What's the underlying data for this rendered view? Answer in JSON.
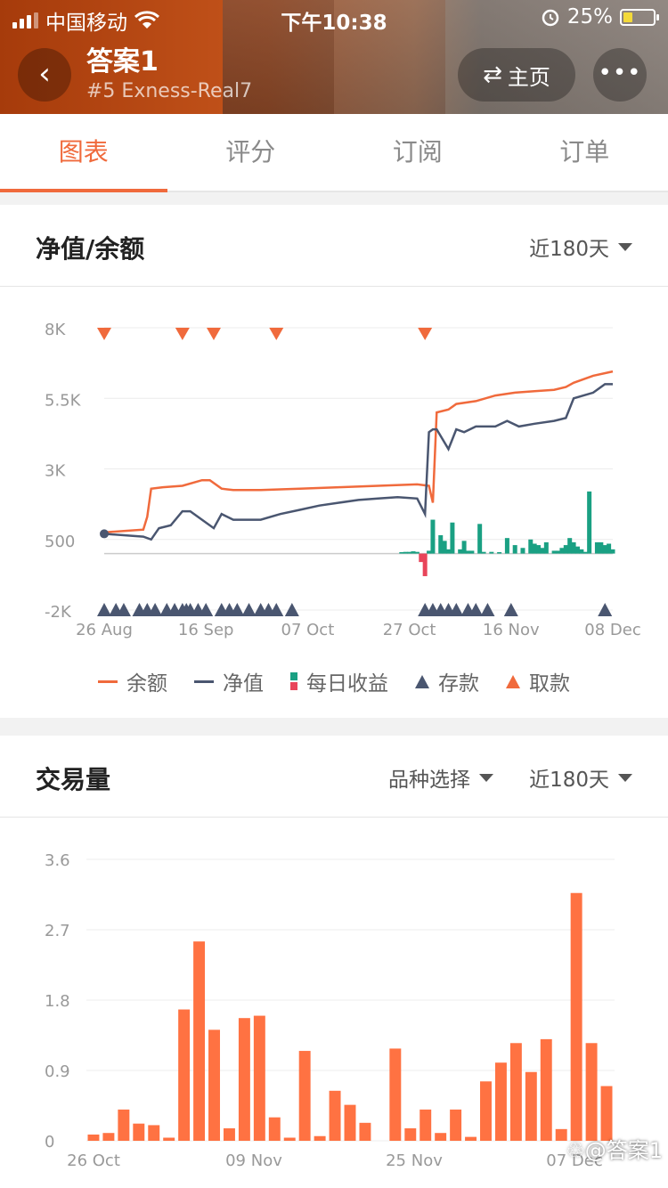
{
  "status_bar": {
    "carrier": "中国移动",
    "time": "下午10:38",
    "battery": "25%"
  },
  "header": {
    "title": "答案1",
    "subtitle": "#5 Exness-Real7",
    "home_label": "主页"
  },
  "tabs": [
    {
      "label": "图表"
    },
    {
      "label": "评分"
    },
    {
      "label": "订阅"
    },
    {
      "label": "订单"
    }
  ],
  "equity_card": {
    "title": "净值/余额",
    "period": "近180天",
    "legend": {
      "balance": "余额",
      "equity": "净值",
      "daily_profit": "每日收益",
      "deposit": "存款",
      "withdrawal": "取款"
    }
  },
  "volume_card": {
    "title": "交易量",
    "symbol_select": "品种选择",
    "period": "近180天"
  },
  "watermark": "答案1",
  "colors": {
    "accent": "#f06a3c",
    "equity": "#4a5670",
    "profit": "#1aa083",
    "loss": "#e8455a",
    "bar": "#ff7242"
  },
  "chart_data": [
    {
      "type": "line",
      "title": "净值/余额",
      "x_ticks": [
        "26 Aug",
        "16 Sep",
        "07 Oct",
        "27 Oct",
        "16 Nov",
        "08 Dec"
      ],
      "y_ticks": [
        "8K",
        "5.5K",
        "3K",
        "500",
        "-2K"
      ],
      "ylim": [
        -2000,
        8000
      ],
      "grid": true,
      "legend_position": "bottom",
      "series": [
        {
          "name": "余额",
          "x": [
            0,
            5,
            10,
            11,
            12,
            15,
            20,
            25,
            27,
            30,
            33,
            36,
            40,
            50,
            60,
            70,
            80,
            83,
            84,
            85,
            88,
            90,
            95,
            100,
            105,
            110,
            115,
            118,
            120,
            125,
            130
          ],
          "values": [
            750,
            800,
            850,
            1300,
            2300,
            2350,
            2400,
            2600,
            2600,
            2300,
            2250,
            2250,
            2250,
            2300,
            2350,
            2400,
            2450,
            2400,
            1800,
            5000,
            5100,
            5300,
            5400,
            5600,
            5700,
            5750,
            5800,
            5900,
            6050,
            6300,
            6450
          ]
        },
        {
          "name": "净值",
          "x": [
            0,
            5,
            10,
            12,
            14,
            17,
            20,
            22,
            25,
            28,
            30,
            33,
            36,
            40,
            45,
            50,
            55,
            60,
            65,
            70,
            75,
            80,
            82,
            83,
            84,
            85,
            88,
            90,
            92,
            95,
            100,
            103,
            106,
            110,
            115,
            118,
            120,
            125,
            128,
            130
          ],
          "values": [
            700,
            650,
            600,
            500,
            900,
            1000,
            1500,
            1500,
            1200,
            900,
            1400,
            1200,
            1200,
            1200,
            1400,
            1550,
            1700,
            1800,
            1900,
            1950,
            2000,
            1950,
            1400,
            4300,
            4400,
            4400,
            3700,
            4400,
            4300,
            4500,
            4500,
            4700,
            4500,
            4600,
            4700,
            4800,
            5500,
            5700,
            6000,
            6000
          ]
        }
      ],
      "daily_profit": {
        "x": [
          76,
          77,
          78,
          79,
          80,
          81,
          82,
          83,
          84,
          86,
          87,
          88,
          89,
          91,
          92,
          93,
          94,
          96,
          97,
          99,
          101,
          103,
          105,
          107,
          109,
          110,
          111,
          112,
          113,
          115,
          116,
          117,
          118,
          119,
          120,
          121,
          122,
          123,
          124,
          126,
          127,
          128,
          129,
          130
        ],
        "values": [
          50,
          60,
          60,
          80,
          60,
          -300,
          -800,
          100,
          1200,
          650,
          450,
          150,
          1100,
          150,
          450,
          100,
          100,
          1050,
          60,
          60,
          50,
          550,
          300,
          200,
          500,
          350,
          300,
          200,
          400,
          100,
          100,
          200,
          300,
          550,
          400,
          250,
          150,
          60,
          2200,
          400,
          400,
          300,
          350,
          150
        ]
      },
      "deposits_x": [
        0,
        3,
        5,
        9,
        11,
        13,
        16,
        18,
        20,
        21,
        22,
        24,
        26,
        30,
        32,
        34,
        37,
        40,
        42,
        44,
        48,
        82,
        84,
        86,
        88,
        90,
        93,
        95,
        98,
        104,
        128
      ],
      "withdrawals_x": [
        0,
        20,
        28,
        44,
        82
      ]
    },
    {
      "type": "bar",
      "title": "交易量",
      "x_ticks": [
        "26 Oct",
        "09 Nov",
        "25 Nov",
        "07 Dec"
      ],
      "y_ticks": [
        "3.6",
        "2.7",
        "1.8",
        "0.9",
        "0"
      ],
      "ylim": [
        0,
        3.6
      ],
      "grid": true,
      "values": [
        0.08,
        0.1,
        0.4,
        0.22,
        0.2,
        0.04,
        1.68,
        2.55,
        1.42,
        0.16,
        1.57,
        1.6,
        0.3,
        0.04,
        1.15,
        0.06,
        0.64,
        0.46,
        0.23,
        0,
        1.18,
        0.16,
        0.4,
        0.1,
        0.4,
        0.05,
        0.76,
        1.0,
        1.25,
        0.88,
        1.3,
        0.15,
        3.17,
        1.25,
        0.7
      ]
    }
  ]
}
